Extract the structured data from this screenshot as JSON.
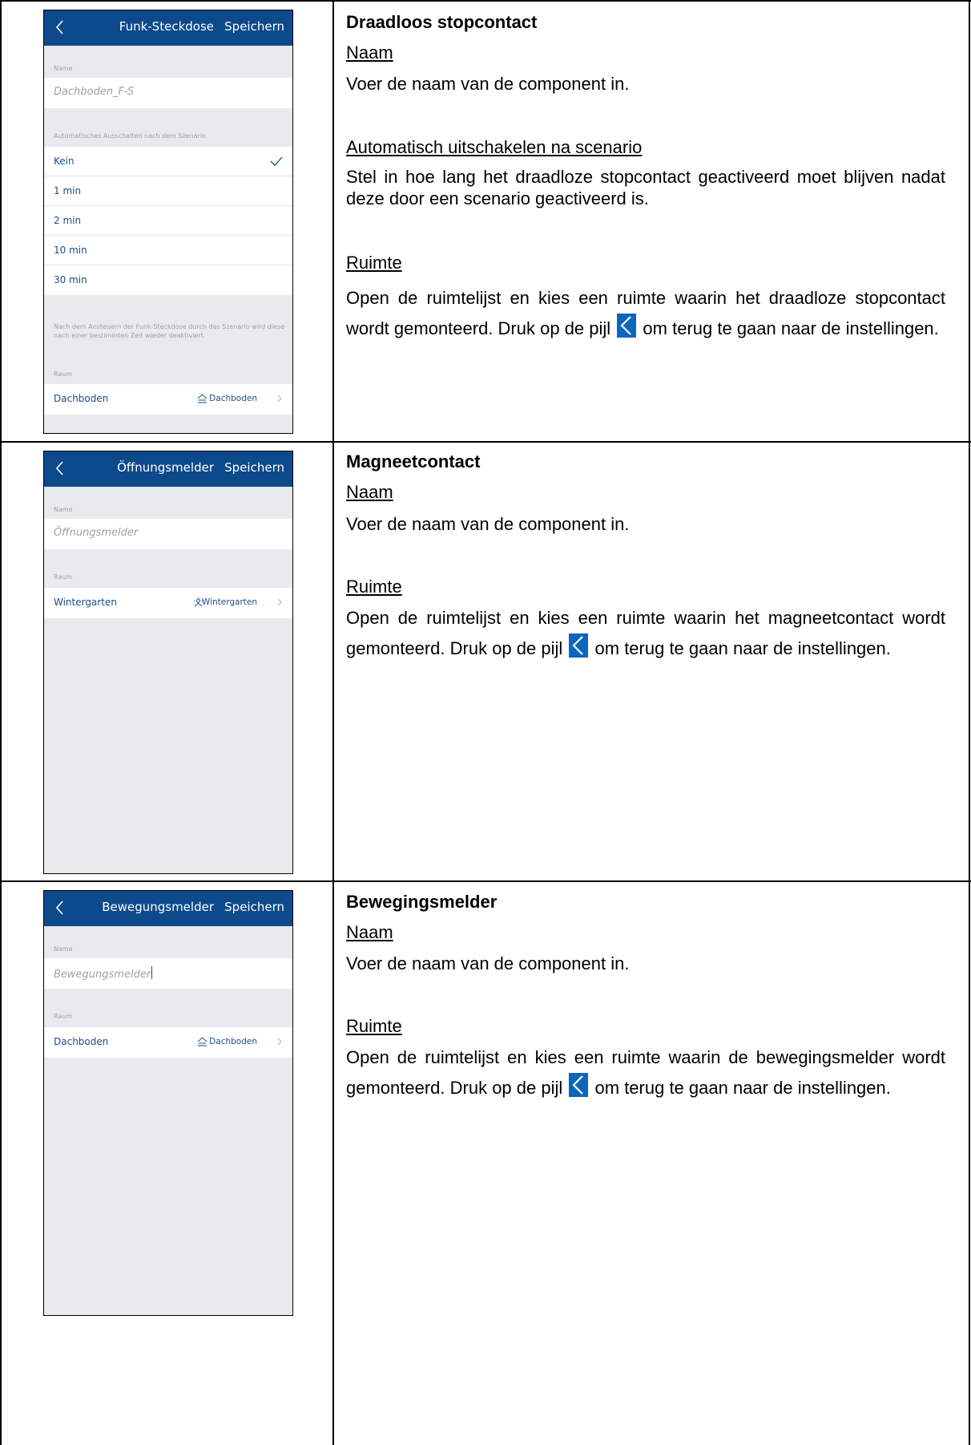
{
  "rows": [
    {
      "phone": {
        "header_title": "Funk-Steckdose",
        "save_label": "Speichern",
        "name_label": "Name",
        "name_value": "Dachboden_F-S",
        "auto_off_label": "Automatisches Ausschalten nach dem Szenario",
        "options": [
          "Kein",
          "1 min",
          "2 min",
          "10 min",
          "30 min"
        ],
        "selected_option": "Kein",
        "note": "Nach dem Ansteuern der Funk-Steckdose durch das Szenario wird diese nach einer bestimmten Zeit wieder deaktiviert.",
        "room_label": "Raum",
        "room_row_label": "Dachboden",
        "room_value": "Dachboden",
        "room_icon": "attic-icon"
      },
      "doc": {
        "title": "Draadloos stopcontact",
        "name_heading": "Naam",
        "name_text": "Voer de naam van de component in.",
        "auto_heading": "Automatisch uitschakelen na scenario",
        "auto_text": "Stel in hoe lang het draadloze stopcontact geactiveerd moet blijven nadat deze door een scenario geactiveerd is.",
        "room_heading": "Ruimte",
        "room_text_before": "Open de ruimtelijst en kies een ruimte waarin het draadloze stopcontact wordt gemonteerd. Druk op de pijl",
        "room_text_after": "om terug te gaan naar de instellingen."
      }
    },
    {
      "phone": {
        "header_title": "Öffnungsmelder",
        "save_label": "Speichern",
        "name_label": "Name",
        "name_value": "Öffnungsmelder",
        "room_label": "Raum",
        "room_row_label": "Wintergarten",
        "room_value": "Wintergarten",
        "room_icon": "wintergarden-icon"
      },
      "doc": {
        "title": "Magneetcontact",
        "name_heading": "Naam",
        "name_text": "Voer de naam van de component in.",
        "room_heading": "Ruimte",
        "room_text_before": "Open de ruimtelijst en kies een ruimte waarin het magneetcontact wordt gemonteerd. Druk op de pijl",
        "room_text_after": "om terug te gaan naar de instellingen."
      }
    },
    {
      "phone": {
        "header_title": "Bewegungsmelder",
        "save_label": "Speichern",
        "name_label": "Name",
        "name_value": "Bewegungsmelder",
        "room_label": "Raum",
        "room_row_label": "Dachboden",
        "room_value": "Dachboden",
        "room_icon": "attic-icon"
      },
      "doc": {
        "title": "Bewegingsmelder",
        "name_heading": "Naam",
        "name_text": "Voer de naam van de component in.",
        "room_heading": "Ruimte",
        "room_text_before": "Open de ruimtelijst en kies een ruimte waarin de bewegingsmelder wordt gemonteerd. Druk op de pijl",
        "room_text_after": "om terug te gaan naar de instellingen."
      }
    }
  ],
  "colors": {
    "header_blue": "#0d4a8b",
    "link_blue": "#1c4d86",
    "icon_blue": "#0d66bd",
    "phone_bg": "#e8eaee"
  }
}
